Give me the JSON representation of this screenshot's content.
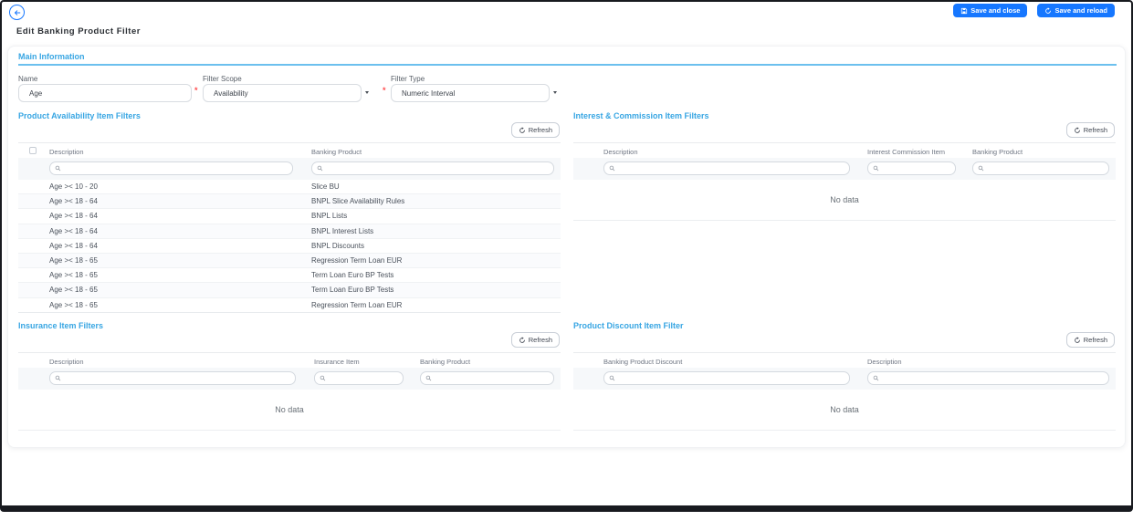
{
  "page_title": "Edit Banking Product Filter",
  "toolbar": {
    "save_and_close_label": "Save and close",
    "save_and_reload_label": "Save and reload"
  },
  "colors": {
    "primary_blue": "#1677ff",
    "section_heading_blue": "#38a6e3",
    "required_red": "#ff4d4f"
  },
  "icons": {
    "back": "arrow-left-circle",
    "save_and_close": "floppy-disk",
    "save_and_reload": "reload-circular-arrow",
    "refresh": "refresh-circular-arrow",
    "search": "magnifier",
    "select_caret": "caret-down",
    "select_all": "checkbox"
  },
  "main_information": {
    "title": "Main Information",
    "fields": [
      {
        "label": "Name",
        "value": "Age",
        "required": false,
        "type": "text"
      },
      {
        "label": "Filter Scope",
        "value": "Availability",
        "required": true,
        "type": "select"
      },
      {
        "label": "Filter Type",
        "value": "Numeric Interval",
        "required": true,
        "type": "select"
      }
    ]
  },
  "refresh_label": "Refresh",
  "empty_text": "No data",
  "sections": [
    {
      "title": "Product Availability Item Filters",
      "columns": [
        "Description",
        "Banking Product"
      ],
      "has_select_all_checkbox": true,
      "rows": [
        [
          "Age >< 10 - 20",
          "Slice BU"
        ],
        [
          "Age >< 18 - 64",
          "BNPL Slice Availability Rules"
        ],
        [
          "Age >< 18 - 64",
          "BNPL Lists"
        ],
        [
          "Age >< 18 - 64",
          "BNPL Interest Lists"
        ],
        [
          "Age >< 18 - 64",
          "BNPL Discounts"
        ],
        [
          "Age >< 18 - 65",
          "Regression Term Loan EUR"
        ],
        [
          "Age >< 18 - 65",
          "Term Loan Euro BP Tests"
        ],
        [
          "Age >< 18 - 65",
          "Term Loan Euro BP Tests"
        ],
        [
          "Age >< 18 - 65",
          "Regression Term Loan EUR"
        ]
      ]
    },
    {
      "title": "Interest & Commission Item Filters",
      "columns": [
        "Description",
        "Interest Commission Item",
        "Banking Product"
      ],
      "has_select_all_checkbox": false,
      "rows": []
    },
    {
      "title": "Insurance Item Filters",
      "columns": [
        "Description",
        "Insurance Item",
        "Banking Product"
      ],
      "has_select_all_checkbox": false,
      "rows": []
    },
    {
      "title": "Product Discount Item Filter",
      "columns": [
        "Banking Product Discount",
        "Description"
      ],
      "has_select_all_checkbox": false,
      "rows": []
    }
  ]
}
